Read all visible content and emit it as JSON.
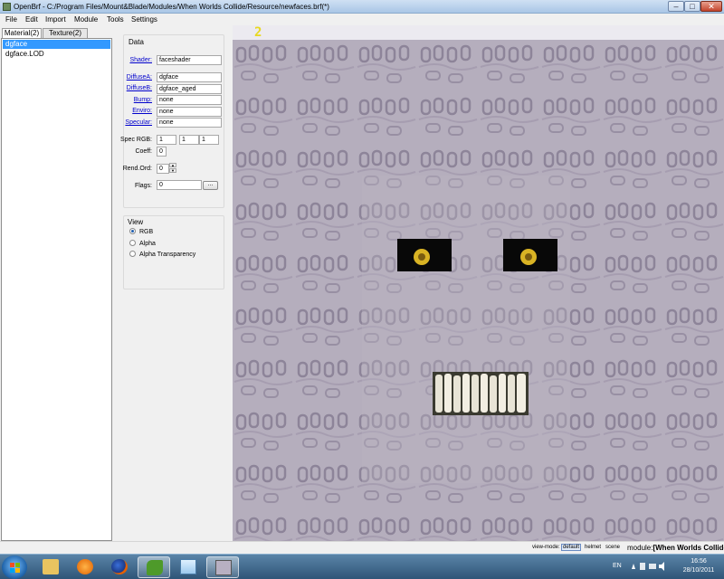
{
  "window": {
    "title": "OpenBrf - C:/Program Files/Mount&Blade/Modules/When Worlds Collide/Resource/newfaces.brf(*)",
    "minimize": "‒",
    "maximize": "□",
    "close": "✕"
  },
  "menu": [
    "File",
    "Edit",
    "Import",
    "Module",
    "Tools",
    "Settings"
  ],
  "tabs": [
    "Material(2)",
    "Texture(2)"
  ],
  "list": [
    {
      "label": "dgface",
      "selected": true
    },
    {
      "label": "dgface.LOD",
      "selected": false
    }
  ],
  "data_panel": {
    "title": "Data",
    "fields": [
      {
        "label": "Shader:",
        "value": "faceshader"
      },
      {
        "label": "DiffuseA:",
        "value": "dgface"
      },
      {
        "label": "DiffuseB:",
        "value": "dgface_aged"
      },
      {
        "label": "Bump:",
        "value": "none"
      },
      {
        "label": "Enviro:",
        "value": "none"
      },
      {
        "label": "Specular:",
        "value": "none"
      }
    ],
    "spec_rgb_label": "Spec RGB:",
    "spec_rgb": [
      "1",
      "1",
      "1"
    ],
    "coeff_label": "Coeff:",
    "coeff": "0",
    "rend_ord_label": "Rend.Ord:",
    "rend_ord": "0",
    "flags_label": "Flags:",
    "flags": "0",
    "flags_button": "..."
  },
  "view_panel": {
    "title": "View",
    "options": [
      "RGB",
      "Alpha",
      "Alpha Transparency"
    ],
    "selected": 0
  },
  "viewport": {
    "lod_number": "2"
  },
  "statusbar": {
    "view_mode_label": "view-mode:",
    "modes": [
      "default",
      "helmet",
      "scene"
    ],
    "active_mode": "default",
    "module_label": "module:",
    "module_name": "[When Worlds Collide]"
  },
  "taskbar": {
    "language": "EN",
    "time": "16:56",
    "date": "28/10/2011",
    "apps": [
      "libraries-folder-icon",
      "media-player-icon",
      "firefox-icon",
      "openbrf-snake-icon",
      "notepad-icon",
      "openbrf-window-icon"
    ]
  },
  "colors": {
    "selection": "#3399ff",
    "link": "#0000cc",
    "texture_background": "#aba3b4",
    "texture_stroke": "#7e748b",
    "eye_patch": "#080808",
    "eye_iris": "#d9b324",
    "lod_number": "#e8d820"
  }
}
